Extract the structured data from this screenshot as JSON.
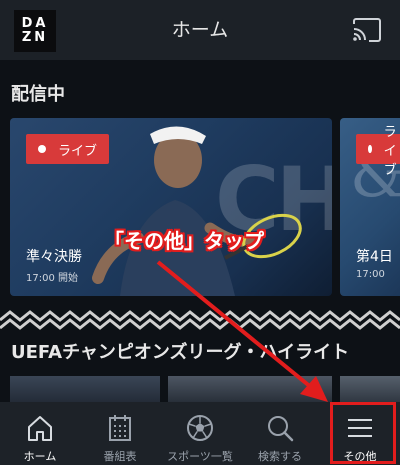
{
  "header": {
    "logo_lines": [
      "DA",
      "ZN"
    ],
    "title": "ホーム",
    "cast_icon": "cast-icon"
  },
  "live_section": {
    "label": "配信中",
    "cards": [
      {
        "badge": "ライブ",
        "title": "準々決勝",
        "time": "17:00 開始",
        "bg_text": "CH"
      },
      {
        "badge": "ライブ",
        "title": "第4日",
        "time": "17:00",
        "bg_text": "&"
      }
    ]
  },
  "highlight_section": {
    "label": "UEFAチャンピオンズリーグ・ハイライト"
  },
  "nav": {
    "items": [
      {
        "label": "ホーム",
        "icon": "home-icon",
        "active": true
      },
      {
        "label": "番組表",
        "icon": "calendar-icon",
        "active": false
      },
      {
        "label": "スポーツ一覧",
        "icon": "soccer-ball-icon",
        "active": false
      },
      {
        "label": "検索する",
        "icon": "search-icon",
        "active": false
      },
      {
        "label": "その他",
        "icon": "menu-icon",
        "active": false
      }
    ]
  },
  "annotation": {
    "text": "「その他」タップ",
    "color": "#e21d1d"
  },
  "colors": {
    "header_bg": "#1c2127",
    "page_bg": "#0d1116",
    "live_red": "#d83a3a",
    "nav_bg": "#1d2228"
  }
}
